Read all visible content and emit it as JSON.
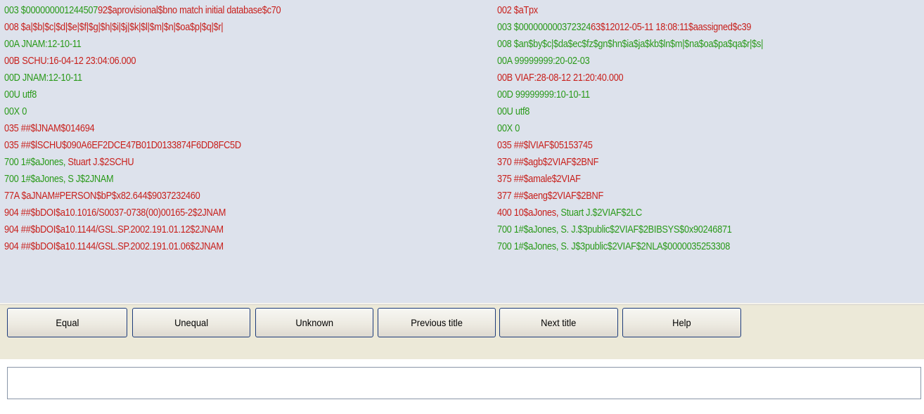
{
  "left_record": [
    [
      {
        "t": "003 $000000001244507",
        "c": "g"
      },
      {
        "t": "92$aprovisional$bno match initial database$c70",
        "c": "r"
      }
    ],
    [
      {
        "t": "008 $a|$b|$c|$d|$e|$f|$g|$h|$i|$j|$k|$l|$m|$n|$oa$p|$q|$r|",
        "c": "r"
      }
    ],
    [
      {
        "t": "00A JNAM:12-10-11",
        "c": "g"
      }
    ],
    [
      {
        "t": "00B SCHU:16-04-12 23:04:06.000",
        "c": "r"
      }
    ],
    [
      {
        "t": "00D JNAM:12-10-11",
        "c": "g"
      }
    ],
    [
      {
        "t": "00U utf8",
        "c": "g"
      }
    ],
    [
      {
        "t": "00X 0",
        "c": "g"
      }
    ],
    [
      {
        "t": "035 ##$lJNAM$014694",
        "c": "r"
      }
    ],
    [
      {
        "t": "035 ##$lSCHU$090A6EF2DCE47B01D0133874F6DD8FC5D",
        "c": "r"
      }
    ],
    [
      {
        "t": "700 1#$aJones, ",
        "c": "g"
      },
      {
        "t": "Stuart J.$2SCHU",
        "c": "r"
      }
    ],
    [
      {
        "t": "700 1#$aJones, S J$2JNAM",
        "c": "g"
      }
    ],
    [
      {
        "t": "77A $aJNAM#PERSON$bP$x82.644$9037232460",
        "c": "r"
      }
    ],
    [
      {
        "t": "904 ##$bDOI$a10.1016/S0037-0738(00)00165-2$2JNAM",
        "c": "r"
      }
    ],
    [
      {
        "t": "904 ##$bDOI$a10.1144/GSL.SP.2002.191.01.12$2JNAM",
        "c": "r"
      }
    ],
    [
      {
        "t": "904 ##$bDOI$a10.1144/GSL.SP.2002.191.01.06$2JNAM",
        "c": "r"
      }
    ]
  ],
  "right_record": [
    [
      {
        "t": "002 $aTpx",
        "c": "r"
      }
    ],
    [
      {
        "t": "003 $000000000372324",
        "c": "g"
      },
      {
        "t": "63$12012-05-11 18:08:11$aassigned$c39",
        "c": "r"
      }
    ],
    [
      {
        "t": "008 $an$by$c|$da$ec$fz$gn$hn$ia$ja$kb$ln$m|$na$oa$pa$qa$r|$s|",
        "c": "g"
      }
    ],
    [
      {
        "t": "00A 99999999:20-02-03",
        "c": "g"
      }
    ],
    [
      {
        "t": "00B VIAF:28-08-12 21:20:40.000",
        "c": "r"
      }
    ],
    [
      {
        "t": "00D 99999999:10-10-11",
        "c": "g"
      }
    ],
    [
      {
        "t": "00U utf8",
        "c": "g"
      }
    ],
    [
      {
        "t": "00X 0",
        "c": "g"
      }
    ],
    [
      {
        "t": "035 ##$lVIAF$05153745",
        "c": "r"
      }
    ],
    [
      {
        "t": "370 ##$agb$2VIAF$2BNF",
        "c": "r"
      }
    ],
    [
      {
        "t": "375 ##$amale$2VIAF",
        "c": "r"
      }
    ],
    [
      {
        "t": "377 ##$aeng$2VIAF$2BNF",
        "c": "r"
      }
    ],
    [
      {
        "t": "400 10$aJones, ",
        "c": "r"
      },
      {
        "t": "Stuart J.$2VIAF$2LC",
        "c": "g"
      }
    ],
    [
      {
        "t": "700 1#$aJones, S. J.$3public$2VIAF$2BIBSYS$0x90246871",
        "c": "g"
      }
    ],
    [
      {
        "t": "700 1#$aJones, S. J$3public$2VIAF$2NLA$0000035253308",
        "c": "g"
      }
    ]
  ],
  "buttons": {
    "equal": "Equal",
    "unequal": "Unequal",
    "unknown": "Unknown",
    "previous": "Previous title",
    "next": "Next title",
    "help": "Help"
  },
  "status_text": "",
  "colors": {
    "green": "#2a9a1a",
    "red": "#c8201c",
    "panel": "#dde2ec",
    "toolbar": "#ece9d8"
  }
}
